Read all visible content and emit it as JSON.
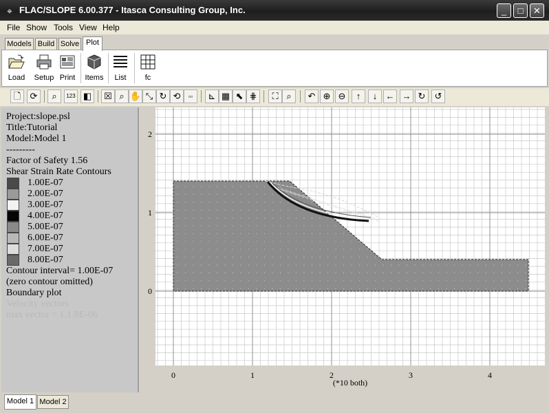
{
  "window": {
    "title": "FLAC/SLOPE 6.00.377 - Itasca Consulting Group, Inc.",
    "controls": {
      "minimize": "_",
      "maximize": "□",
      "close": "✕"
    }
  },
  "menu": [
    "File",
    "Show",
    "Tools",
    "View",
    "Help"
  ],
  "tabs": [
    "Models",
    "Build",
    "Solve",
    "Plot"
  ],
  "active_tab": "Plot",
  "ribbon": {
    "buttons": [
      "Load",
      "Setup",
      "Print",
      "Items",
      "List",
      "fc"
    ]
  },
  "legend": {
    "project": "Project:slope.psl",
    "title": "Title:Tutorial",
    "model": "Model:Model 1",
    "divider": "---------",
    "fos": "Factor of Safety  1.56",
    "contours_title": "Shear Strain Rate Contours",
    "contours": [
      {
        "label": "1.00E-07",
        "color": "#4a4a4a"
      },
      {
        "label": "2.00E-07",
        "color": "#9a9a9a"
      },
      {
        "label": "3.00E-07",
        "color": "#f2f2f2"
      },
      {
        "label": "4.00E-07",
        "color": "#060606"
      },
      {
        "label": "5.00E-07",
        "color": "#8a8a8a"
      },
      {
        "label": "6.00E-07",
        "color": "#b8b8b8"
      },
      {
        "label": "7.00E-07",
        "color": "#dcdcdc"
      },
      {
        "label": "8.00E-07",
        "color": "#6a6a6a"
      }
    ],
    "interval": "Contour interval=  1.00E-07",
    "zero_note": "(zero contour omitted)",
    "boundary": "Boundary plot",
    "velocity": "Velocity vectors",
    "max_vector": "max vector =      1.1.8E-06"
  },
  "plot": {
    "x_ticks": [
      "0",
      "1",
      "2",
      "3",
      "4"
    ],
    "y_ticks": [
      "0",
      "1",
      "2"
    ],
    "xlabel": "(*10 both)",
    "slope_fill": "#8c8c8c",
    "grid_color": "#c8c8c8",
    "background": "#ffffff"
  },
  "bottom_tabs": [
    "Model 1",
    "Model 2"
  ],
  "active_bottom_tab": "Model 1"
}
